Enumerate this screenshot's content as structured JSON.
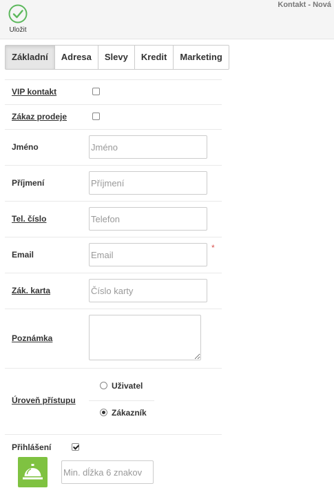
{
  "toolbar": {
    "save_label": "Uložit",
    "save_icon": "check-circle-icon",
    "accent_color": "#5cb85c"
  },
  "page": {
    "title": "Kontakt - Nová"
  },
  "tabs": [
    {
      "label": "Základní",
      "active": true
    },
    {
      "label": "Adresa"
    },
    {
      "label": "Slevy"
    },
    {
      "label": "Kredit"
    },
    {
      "label": "Marketing"
    }
  ],
  "form": {
    "vip": {
      "label": "VIP kontakt",
      "checked": false
    },
    "no_sale": {
      "label": "Zákaz prodeje",
      "checked": false
    },
    "first_name": {
      "label": "Jméno",
      "placeholder": "Jméno",
      "value": ""
    },
    "last_name": {
      "label": "Příjmení",
      "placeholder": "Příjmení",
      "value": ""
    },
    "phone": {
      "label": "Tel. číslo",
      "placeholder": "Telefon",
      "value": ""
    },
    "email": {
      "label": "Email",
      "placeholder": "Email",
      "value": "",
      "required_mark": "*"
    },
    "card": {
      "label": "Zák. karta",
      "placeholder": "Číslo karty",
      "value": ""
    },
    "note": {
      "label": "Poznámka",
      "value": ""
    },
    "access": {
      "label": "Úroveň přístupu",
      "options": [
        "Uživatel",
        "Zákazník"
      ],
      "selected": "Zákazník"
    },
    "login": {
      "label": "Přihlášení",
      "checked": true
    },
    "password": {
      "placeholder": "Min. dĺžka 6 znakov",
      "value": ""
    },
    "bell_icon": "service-bell-icon",
    "bell_color": "#7fc241"
  }
}
